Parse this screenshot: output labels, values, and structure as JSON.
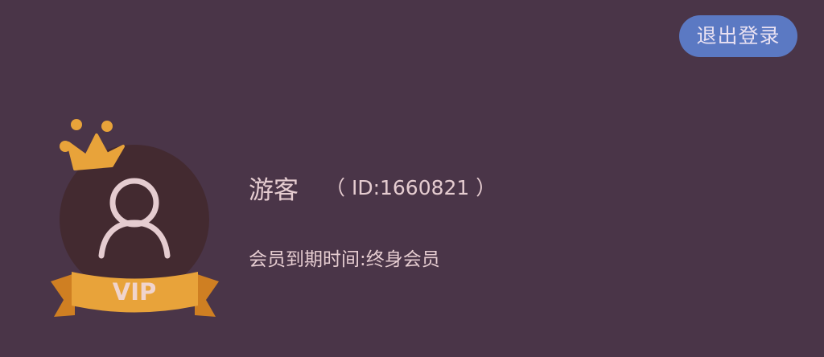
{
  "header": {
    "logout_label": "退出登录"
  },
  "profile": {
    "badge_text": "VIP",
    "username": "游客",
    "user_id": "（ ID:1660821 ）",
    "expiry": "会员到期时间:终身会员"
  },
  "colors": {
    "background": "#4a3548",
    "logout_button": "#5b79c3",
    "crown": "#e8a33a",
    "avatar_circle": "#432a30",
    "avatar_icon": "#e5ccd0",
    "text": "#e5ccd0"
  },
  "icons": {
    "crown": "crown-icon",
    "avatar": "user-icon",
    "ribbon": "vip-ribbon"
  }
}
